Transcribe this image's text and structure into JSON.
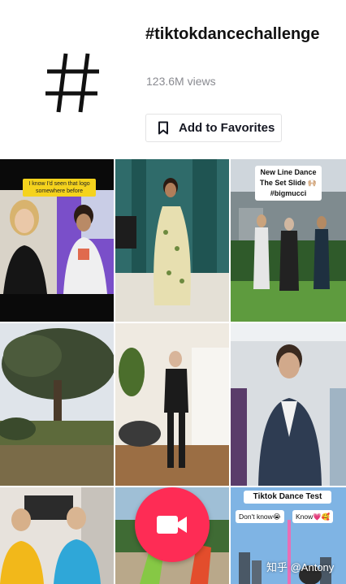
{
  "hashtag": {
    "title": "#tiktokdancechallenge",
    "views": "123.6M views",
    "favorites_label": "Add to Favorites",
    "icon": "hashtag-icon"
  },
  "videos": [
    {
      "caption": "I know I'd seen that logo somewhere before"
    },
    {
      "caption": ""
    },
    {
      "caption_lines": [
        "New Line Dance",
        "The Set Slide 🙌🏼",
        "#bigmucci"
      ]
    },
    {
      "caption": ""
    },
    {
      "caption": ""
    },
    {
      "caption": ""
    },
    {
      "caption": ""
    },
    {
      "caption": ""
    },
    {
      "title": "Tiktok Dance Test",
      "option_left": "Don't know😭",
      "option_right": "Know💗🥰"
    }
  ],
  "record_button": {
    "icon": "video-camera-icon",
    "color": "#fe2c55"
  },
  "watermark": "知乎 @Antony",
  "colors": {
    "accent": "#fe2c55",
    "secondary_text": "#8a8b91",
    "caption_yellow": "#f5d31d"
  }
}
